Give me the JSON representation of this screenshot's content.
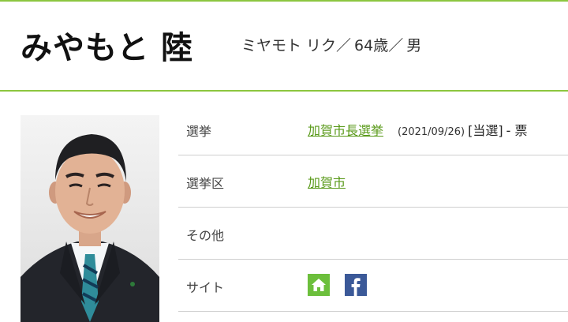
{
  "profile": {
    "name": "みやもと 陸",
    "kana": "ミヤモト リク／",
    "age": "64歳／",
    "gender": "男"
  },
  "details": {
    "election": {
      "label": "選挙",
      "link": "加賀市長選挙",
      "date": "(2021/09/26)",
      "result": "[当選]",
      "votes": "- 票"
    },
    "district": {
      "label": "選挙区",
      "link": "加賀市"
    },
    "other": {
      "label": "その他"
    },
    "site": {
      "label": "サイト",
      "icons": [
        "home-icon",
        "facebook-icon"
      ]
    }
  },
  "colors": {
    "accent": "#8cc63f",
    "link": "#5a9a1a",
    "home_icon_bg": "#6cbf3c",
    "facebook_bg": "#3b5998"
  }
}
